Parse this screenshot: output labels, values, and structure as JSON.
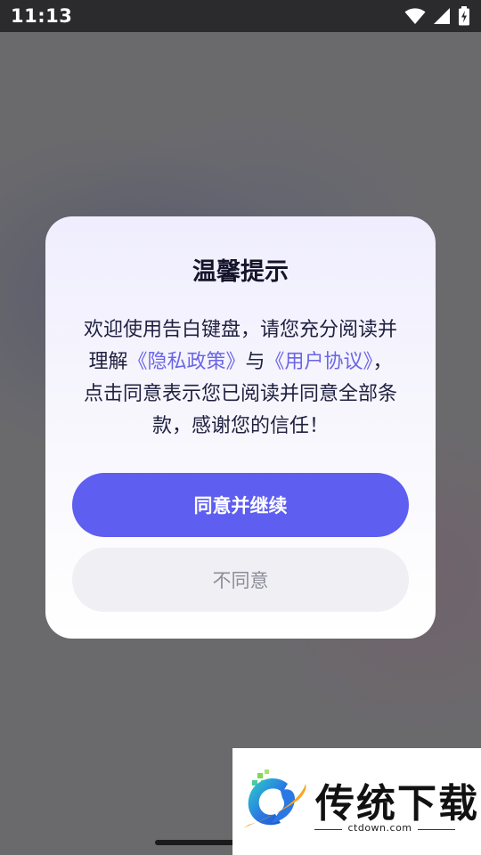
{
  "status_bar": {
    "time": "11:13",
    "icons": [
      "wifi-icon",
      "cell-signal-icon",
      "battery-charging-icon"
    ]
  },
  "dialog": {
    "title": "温馨提示",
    "message_parts": {
      "p1": "欢迎使用告白键盘，请您充分阅读并理解",
      "privacy_link": "《隐私政策》",
      "p2": "与",
      "agreement_link": "《用户协议》",
      "p3": "，点击同意表示您已阅读并同意全部条款，感谢您的信任！"
    },
    "agree_label": "同意并继续",
    "disagree_label": "不同意"
  },
  "watermark": {
    "title": "传统下载",
    "url": "ctdown.com"
  },
  "colors": {
    "accent": "#5e5ef0",
    "link": "#6a66e6",
    "overlay": "#6a6a6d"
  }
}
